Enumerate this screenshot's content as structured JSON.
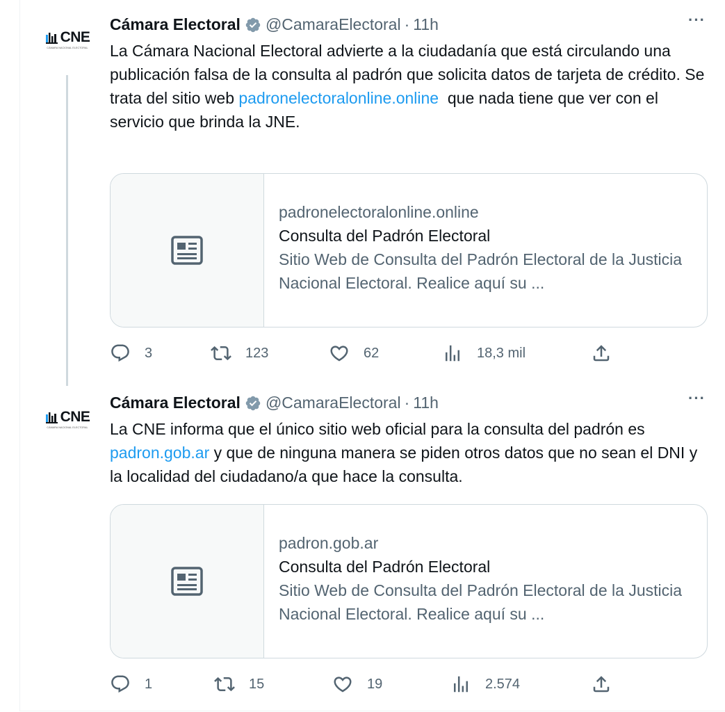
{
  "tweets": [
    {
      "avatar": {
        "logo_text": "CNE",
        "logo_sub": "CÁMARA NACIONAL ELECTORAL"
      },
      "author_name": "Cámara Electoral",
      "handle": "@CamaraElectoral",
      "separator": "·",
      "time": "11h",
      "more": "···",
      "text": {
        "before_link": "La Cámara Nacional Electoral advierte a la ciudadanía que está circulando una publicación falsa de la consulta al padrón que solicita datos de tarjeta de crédito. Se trata del sitio web ",
        "link": "padronelectoralonline.online",
        "after_link": "  que nada tiene que ver con el servicio que brinda la JNE."
      },
      "card": {
        "domain": "padronelectoralonline.online",
        "title": "Consulta del Padrón Electoral",
        "description": "Sitio Web de Consulta del Padrón Electoral de la Justicia Nacional Electoral. Realice aquí su ..."
      },
      "stats": {
        "replies": "3",
        "retweets": "123",
        "likes": "62",
        "views": "18,3 mil"
      }
    },
    {
      "avatar": {
        "logo_text": "CNE",
        "logo_sub": "CÁMARA NACIONAL ELECTORAL"
      },
      "author_name": "Cámara Electoral",
      "handle": "@CamaraElectoral",
      "separator": "·",
      "time": "11h",
      "more": "···",
      "text": {
        "before_link": "La CNE informa que el único sitio web oficial para la consulta del padrón es ",
        "link": "padron.gob.ar",
        "after_link": " y que de ninguna manera se piden otros datos que no sean el DNI y la localidad del ciudadano/a que hace la consulta."
      },
      "card": {
        "domain": "padron.gob.ar",
        "title": "Consulta del Padrón Electoral",
        "description": "Sitio Web de Consulta del Padrón Electoral de la Justicia Nacional Electoral. Realice aquí su ..."
      },
      "stats": {
        "replies": "1",
        "retweets": "15",
        "likes": "19",
        "views": "2.574"
      }
    }
  ],
  "icons": [
    "verified-badge-icon",
    "more-icon",
    "article-icon",
    "reply-icon",
    "retweet-icon",
    "like-icon",
    "views-icon",
    "share-icon"
  ],
  "colors": {
    "link": "#1d9bf0",
    "secondary_text": "#536471",
    "border": "#cfd9de",
    "card_media_bg": "#f7f9f9",
    "verified": "#829aab"
  }
}
